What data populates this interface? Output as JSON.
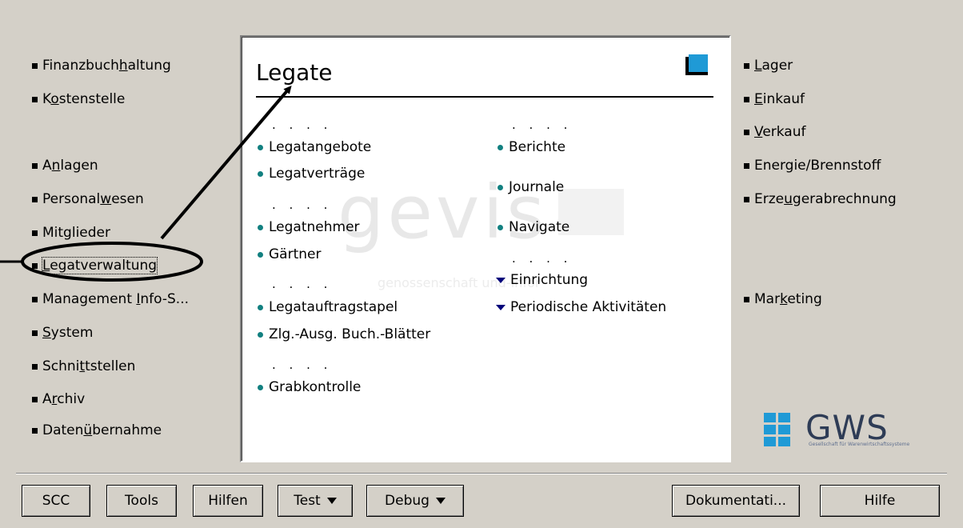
{
  "left_nav": [
    {
      "pre": "Finanzbuch",
      "acc": "h",
      "post": "altung"
    },
    {
      "pre": "K",
      "acc": "o",
      "post": "stenstelle"
    },
    {
      "pre": "A",
      "acc": "n",
      "post": "lagen"
    },
    {
      "pre": "Personal",
      "acc": "w",
      "post": "esen"
    },
    {
      "pre": "Mitglieder",
      "acc": "",
      "post": ""
    },
    {
      "pre": "",
      "acc": "L",
      "post": "egatverwaltung"
    },
    {
      "pre": "Management ",
      "acc": "I",
      "post": "nfo-S..."
    },
    {
      "pre": "",
      "acc": "S",
      "post": "ystem"
    },
    {
      "pre": "Schni",
      "acc": "t",
      "post": "tstellen"
    },
    {
      "pre": "A",
      "acc": "r",
      "post": "chiv"
    },
    {
      "pre": "Daten",
      "acc": "ü",
      "post": "bernahme"
    }
  ],
  "right_nav": [
    {
      "pre": "",
      "acc": "L",
      "post": "ager"
    },
    {
      "pre": "",
      "acc": "E",
      "post": "inkauf"
    },
    {
      "pre": "",
      "acc": "V",
      "post": "erkauf"
    },
    {
      "pre": "Energie/Brennstoff",
      "acc": "",
      "post": ""
    },
    {
      "pre": "Erze",
      "acc": "u",
      "post": "gerabrechnung"
    },
    {
      "pre": "Mar",
      "acc": "k",
      "post": "eting"
    }
  ],
  "panel": {
    "title": "Legate",
    "dots": ". . . .",
    "col1": [
      "Legatangebote",
      "Legatverträge",
      "Legatnehmer",
      "Gärtner",
      "Legatauftragstapel",
      "Zlg.-Ausg. Buch.-Blätter",
      "Grabkontrolle"
    ],
    "col2": [
      "Berichte",
      "Journale",
      "Navigate"
    ],
    "col2_groups": [
      "Einrichtung",
      "Periodische Aktivitäten"
    ],
    "watermark": "gevis",
    "watermark_sub": "genossenschaft und-Infor"
  },
  "logo": {
    "text": "GWS",
    "subtext": "Gesellschaft für Warenwirtschaftssysteme"
  },
  "buttons": {
    "scc": "SCC",
    "tools": "Tools",
    "hilfen": "Hilfen",
    "test": "Test",
    "debug": "Debug",
    "doku": "Dokumentati...",
    "hilfe": "Hilfe"
  },
  "colors": {
    "background": "#d4d0c8",
    "bullet": "#128080",
    "group_arrow": "#00007a",
    "book_icon": "#1f9ad6"
  }
}
